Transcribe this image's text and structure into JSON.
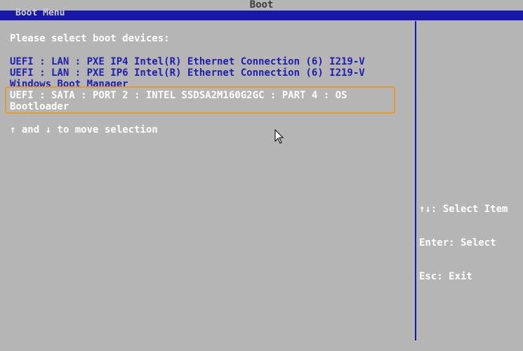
{
  "window": {
    "title": "Boot",
    "menu_label": "Boot Menu"
  },
  "main": {
    "prompt": "Please select boot devices:",
    "boot_devices": [
      "UEFI : LAN : PXE IP4 Intel(R) Ethernet Connection (6) I219-V",
      "UEFI : LAN : PXE IP6 Intel(R) Ethernet Connection (6) I219-V",
      "Windows Boot Manager"
    ],
    "selected_device": {
      "line1": "UEFI : SATA : PORT 2 : INTEL SSDSA2M160G2GC : PART 4 : OS",
      "line2": "Bootloader"
    },
    "hint": "↑ and ↓ to move selection"
  },
  "help_panel": {
    "select_item": "↑↓: Select Item",
    "enter": "Enter: Select",
    "esc": "Esc: Exit"
  },
  "colors": {
    "background": "#b5b5b5",
    "accent_blue": "#1717a8",
    "highlight_border": "#e89a2c"
  },
  "icons": {
    "pointer": "mouse-pointer-icon"
  }
}
